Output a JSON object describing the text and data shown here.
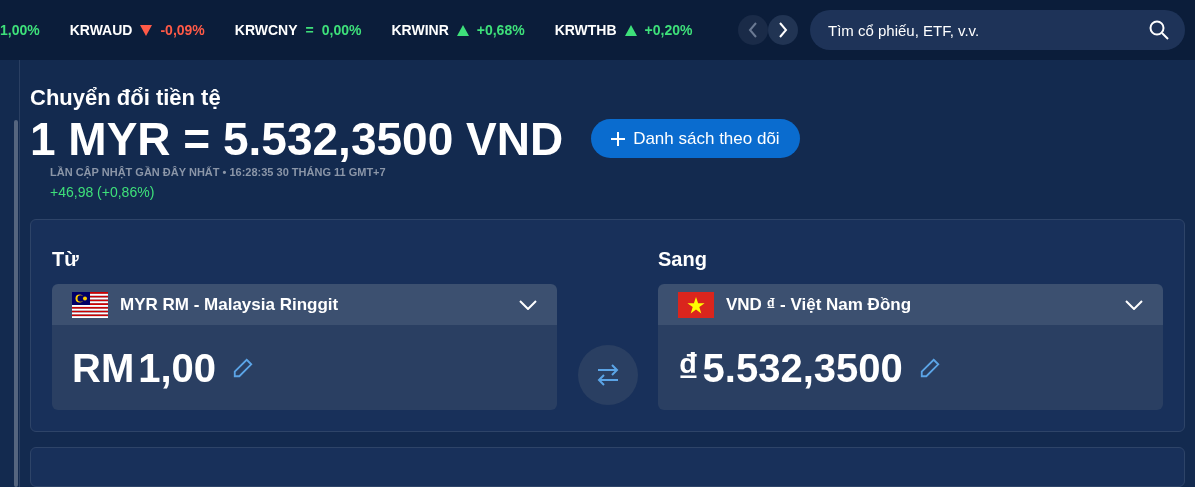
{
  "ticker": [
    {
      "kind": "clipped",
      "change": "1,00%"
    },
    {
      "kind": "loss",
      "symbol": "KRWAUD",
      "change": "-0,09%"
    },
    {
      "kind": "flat",
      "symbol": "KRWCNY",
      "change": "0,00%",
      "flat_mark": "="
    },
    {
      "kind": "gain",
      "symbol": "KRWINR",
      "change": "+0,68%"
    },
    {
      "kind": "gain",
      "symbol": "KRWTHB",
      "change": "+0,20%"
    }
  ],
  "search": {
    "placeholder": "Tìm cổ phiếu, ETF, v.v."
  },
  "title": "Chuyển đổi tiền tệ",
  "rate": "1 MYR = 5.532,3500 VND",
  "watchlist_button": "Danh sách theo dõi",
  "updated": "LẦN CẬP NHẬT GẦN ĐÂY NHẤT • 16:28:35 30 THÁNG 11 GMT+7",
  "change": {
    "text": "+46,98 (+0,86%)",
    "kind": "gain"
  },
  "converter": [
    {
      "label": "Từ",
      "currency": "MYR RM - Malaysia Ringgit",
      "symbol": "RM",
      "amount": "1,00"
    },
    {
      "label": "Sang",
      "currency": "VND ₫ - Việt Nam Đồng",
      "symbol": "₫",
      "amount": "5.532,3500"
    }
  ]
}
